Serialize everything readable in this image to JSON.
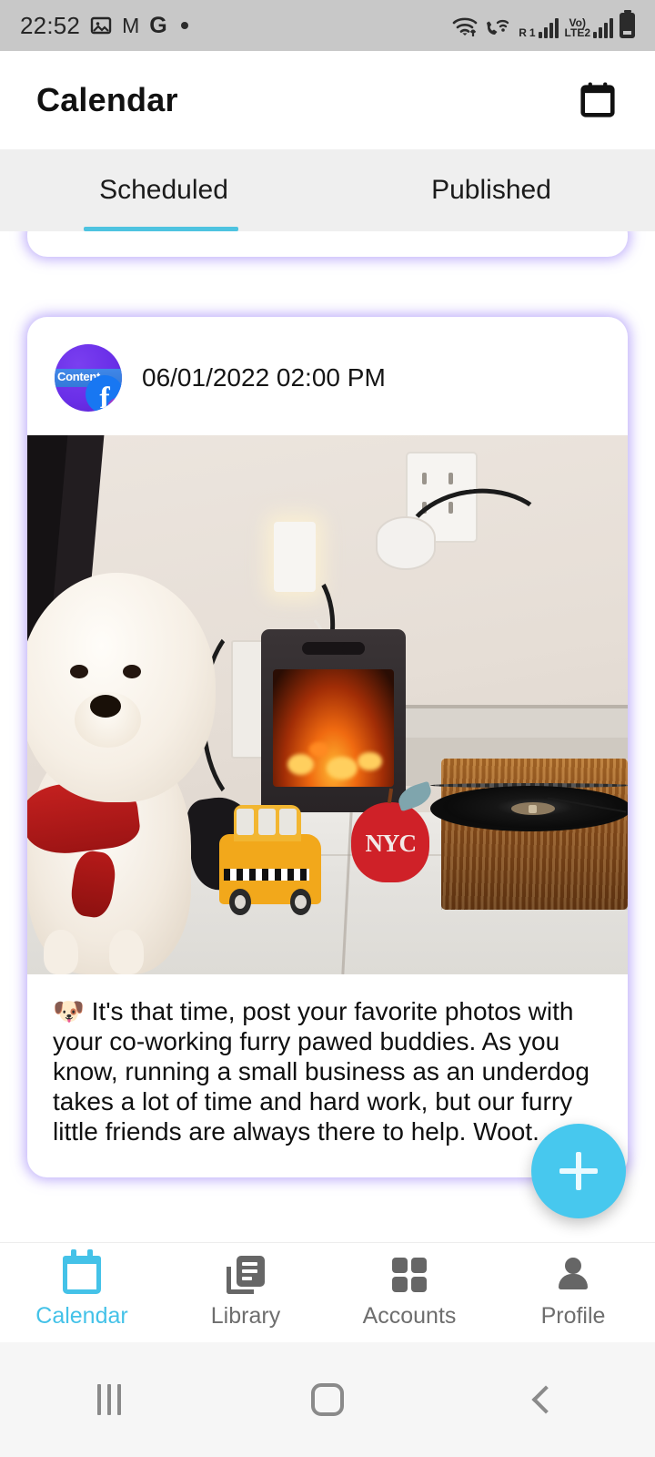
{
  "status_bar": {
    "time": "22:52",
    "left_icons": [
      "photos-icon",
      "gmail-icon",
      "google-icon",
      "dot-indicator"
    ],
    "gmail_glyph": "M",
    "google_glyph": "G",
    "right_icons": [
      "wifi-icon",
      "call-wifi-icon",
      "signal-r-icon",
      "volte-signal-icon",
      "battery-icon"
    ],
    "roaming_label": "R",
    "roaming_sub": "1",
    "volte_label": "Vo)",
    "network_label": "LTE2"
  },
  "app_bar": {
    "title": "Calendar",
    "action_icon": "calendar-icon"
  },
  "tabs": {
    "items": [
      {
        "label": "Scheduled",
        "active": true
      },
      {
        "label": "Published",
        "active": false
      }
    ],
    "indicator_color": "#4ec3e0"
  },
  "feed": {
    "cards": [
      {
        "partial": true
      },
      {
        "partial": false,
        "avatar": {
          "brand_text": "Content",
          "platform_badge": "facebook-badge",
          "facebook_glyph": "f",
          "meta_glyph": "∞"
        },
        "date": "06/01/2022 02:00 PM",
        "media_alt": "white-dog-photo",
        "caption": "🐶 It's that time, post your favorite photos with your co-working furry pawed buddies. As you know, running a small business as an underdog takes a lot of time and hard work, but our furry little friends are always there to help. Woot.",
        "photo_objects": {
          "apple_text": "NYC"
        }
      }
    ],
    "card_glow_color": "#8a6ef6"
  },
  "fab": {
    "icon": "plus-icon",
    "color": "#47c8ee"
  },
  "bottom_nav": {
    "items": [
      {
        "label": "Calendar",
        "icon": "calendar-icon",
        "active": true
      },
      {
        "label": "Library",
        "icon": "library-icon",
        "active": false
      },
      {
        "label": "Accounts",
        "icon": "grid-icon",
        "active": false
      },
      {
        "label": "Profile",
        "icon": "person-icon",
        "active": false
      }
    ],
    "active_color": "#44c2e8",
    "inactive_color": "#6e6e6e"
  },
  "system_nav": {
    "buttons": [
      "recents-icon",
      "home-icon",
      "back-icon"
    ]
  }
}
